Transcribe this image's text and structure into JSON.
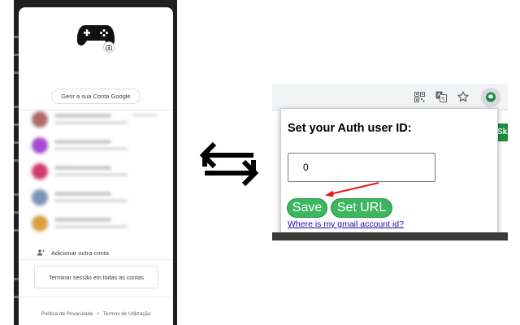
{
  "left_panel": {
    "manage_button": "Gerir a sua Conta Google",
    "add_account": "Adicionar outra conta",
    "sign_out": "Terminar sessão em todas as contas",
    "privacy": "Política de Privacidade",
    "separator": "•",
    "terms": "Termos de Utilização",
    "accounts": [
      {
        "avatar_color": "#b06a6a"
      },
      {
        "avatar_color": "#a64bd1"
      },
      {
        "avatar_color": "#d23a6e"
      },
      {
        "avatar_color": "#7c93b6"
      },
      {
        "avatar_color": "#d9a043"
      }
    ]
  },
  "popup": {
    "title": "Set your Auth user ID:",
    "user_id_value": "0",
    "save_label": "Save",
    "set_url_label": "Set URL",
    "help_link": "Where is my gmail account id?"
  },
  "page_strip_text": "Sk",
  "icons": {
    "toolbar": [
      "qr-code-icon",
      "translate-icon",
      "star-icon",
      "extension-icon"
    ],
    "swap": "swap-arrows-icon",
    "gamepad": "gamepad-icon"
  },
  "colors": {
    "button_green": "#3db660",
    "link_blue": "#1a0dab",
    "arrow_red": "#e01b1b"
  }
}
